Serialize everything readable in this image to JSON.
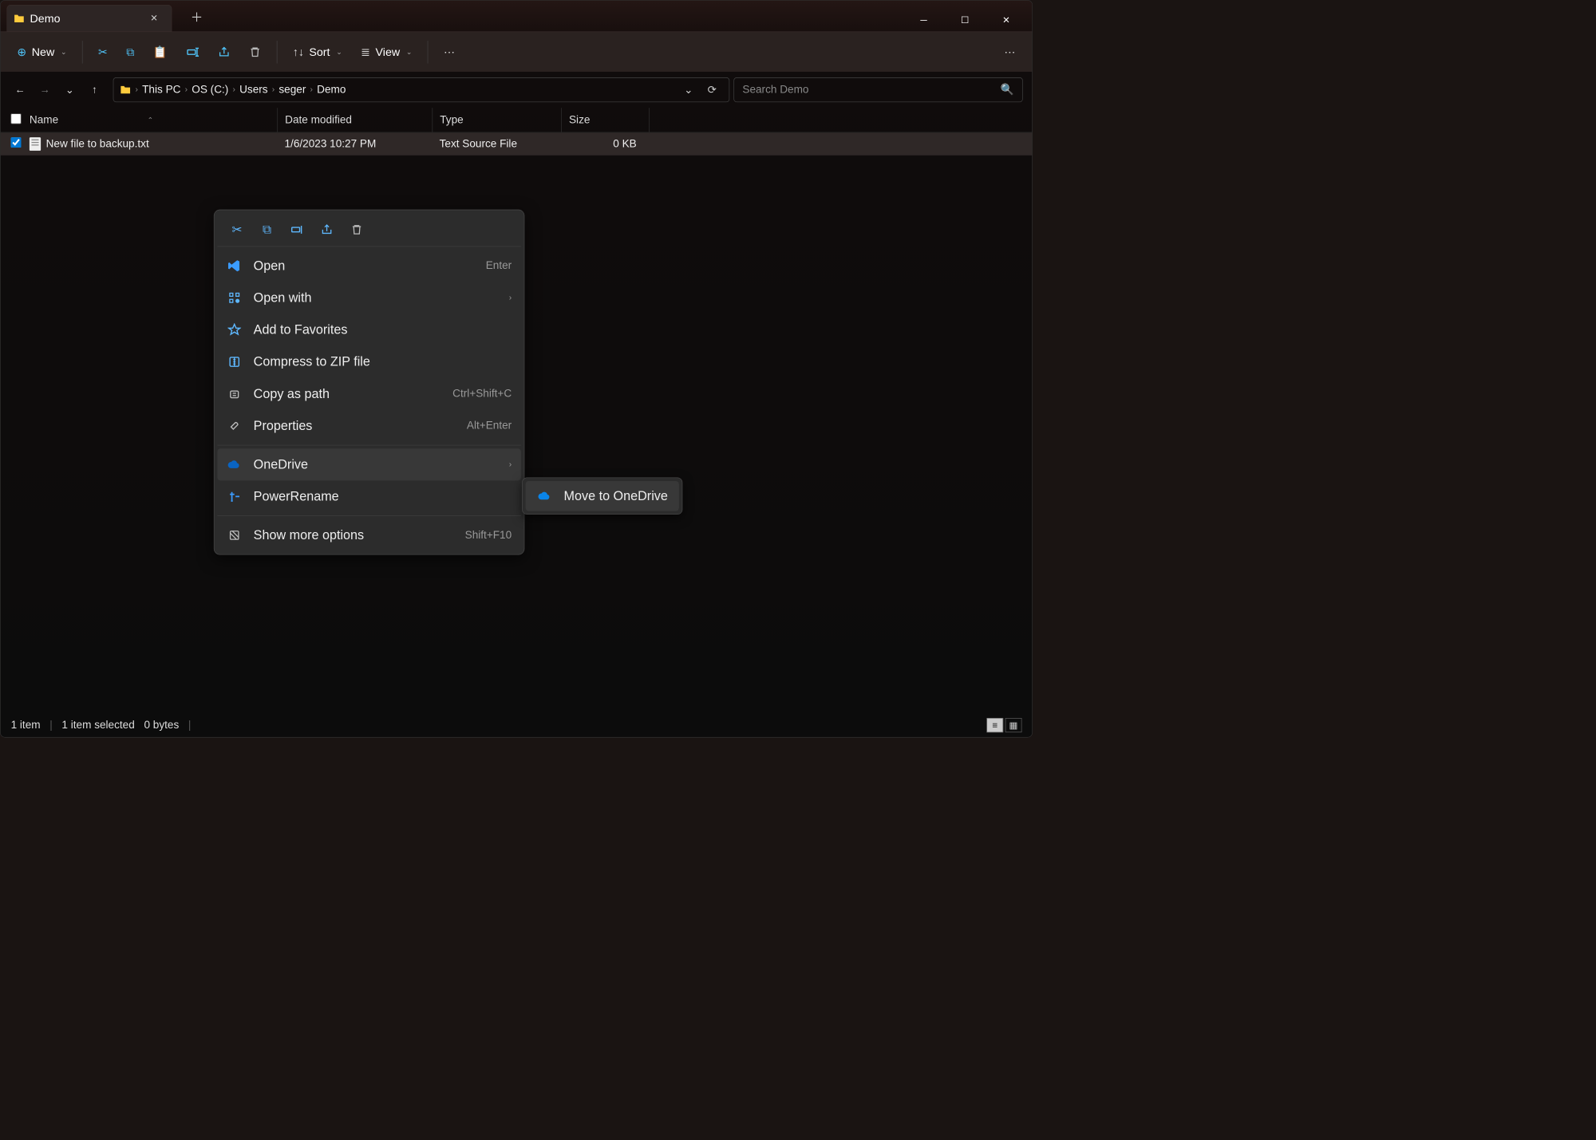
{
  "tab": {
    "title": "Demo"
  },
  "toolbar": {
    "new_label": "New",
    "sort_label": "Sort",
    "view_label": "View"
  },
  "breadcrumb": {
    "items": [
      "This PC",
      "OS (C:)",
      "Users",
      "seger",
      "Demo"
    ]
  },
  "search": {
    "placeholder": "Search Demo"
  },
  "columns": {
    "name": "Name",
    "date": "Date modified",
    "type": "Type",
    "size": "Size"
  },
  "files": [
    {
      "name": "New file to backup.txt",
      "date": "1/6/2023 10:27 PM",
      "type": "Text Source File",
      "size": "0 KB",
      "checked": true
    }
  ],
  "context_menu": {
    "open": "Open",
    "open_shortcut": "Enter",
    "open_with": "Open with",
    "add_favorites": "Add to Favorites",
    "compress": "Compress to ZIP file",
    "copy_path": "Copy as path",
    "copy_path_shortcut": "Ctrl+Shift+C",
    "properties": "Properties",
    "properties_shortcut": "Alt+Enter",
    "onedrive": "OneDrive",
    "powerrename": "PowerRename",
    "show_more": "Show more options",
    "show_more_shortcut": "Shift+F10"
  },
  "submenu": {
    "move_onedrive": "Move to OneDrive"
  },
  "status": {
    "count": "1 item",
    "selected": "1 item selected",
    "bytes": "0 bytes"
  }
}
